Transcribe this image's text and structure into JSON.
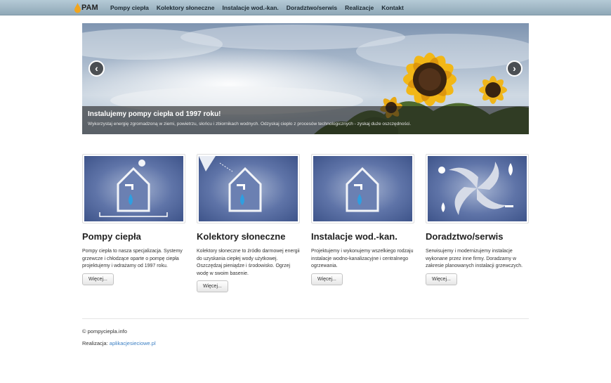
{
  "brand": {
    "name": "PAM"
  },
  "nav": {
    "items": [
      "Pompy ciepła",
      "Kolektory słoneczne",
      "Instalacje wod.-kan.",
      "Doradztwo/serwis",
      "Realizacje",
      "Kontakt"
    ]
  },
  "carousel": {
    "title": "Instalujemy pompy ciepła od 1997 roku!",
    "text": "Wykorzystaj energię zgromadzoną w ziemi, powietrzu, słońcu i zbiornikach wodnych. Odzyskaj ciepło z procesów technologicznych - zyskaj duże oszczędności.",
    "prev_icon": "chevron-left-icon",
    "next_icon": "chevron-right-icon"
  },
  "features": [
    {
      "title": "Pompy ciepła",
      "text": "Pompy ciepła to nasza specjalizacja. Systemy grzewcze i chłodzące oparte o pompę ciepła projektujemy i wdrażamy od 1997 roku.",
      "button": "Więcej..."
    },
    {
      "title": "Kolektory słoneczne",
      "text": "Kolektory słoneczne to źródło darmowej energii do uzyskania ciepłej wody użytkowej. Oszczędzaj pieniądze i środowisko. Ogrzej wodę w swoim basenie.",
      "button": "Więcej..."
    },
    {
      "title": "Instalacje wod.-kan.",
      "text": "Projektujemy i wykonujemy wszelkiego rodzaju instalacje wodno-kanalizacyjne i centralnego ogrzewania.",
      "button": "Więcej..."
    },
    {
      "title": "Doradztwo/serwis",
      "text": "Serwisujemy i modernizujemy instalacje wykonane przez inne firmy. Doradzamy w zakresie planowanych instalacji grzewczych.",
      "button": "Więcej..."
    }
  ],
  "footer": {
    "copyright": "© pompyciepla.info",
    "credit_label": "Realizacja:",
    "credit_link": "aplikacjesieciowe.pl"
  },
  "colors": {
    "accent": "#3d80c4",
    "nav_bg": "#a3bac8",
    "tile_bg": "#5f74a8"
  }
}
